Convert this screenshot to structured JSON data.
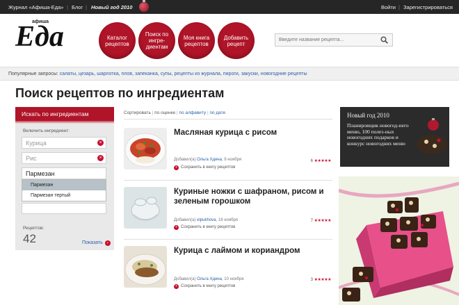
{
  "topbar": {
    "journal": "Журнал «Афиша-Еда»",
    "blog": "Блог",
    "new_year": "Новый год 2010",
    "login": "Войти",
    "register": "Зарегистрироваться",
    "separator": "|"
  },
  "logo": {
    "small": "афиша",
    "main": "Еда"
  },
  "nav": [
    {
      "label": "Каталог рецептов"
    },
    {
      "label": "Поиск по ингре-диентам"
    },
    {
      "label": "Моя книга рецептов"
    },
    {
      "label": "Добавить рецепт"
    }
  ],
  "search": {
    "placeholder": "Введите название рецепта..."
  },
  "popular": {
    "label": "Популярные запросы:",
    "links": [
      "салаты",
      "цезарь",
      "шарлотка",
      "плов",
      "запеканка",
      "супы",
      "рецепты из журнала",
      "пироги",
      "закуски",
      "новогодние рецепты"
    ]
  },
  "page_title": "Поиск рецептов по ингредиентам",
  "panel": {
    "header": "Искать по ингредиентам",
    "include_label": "Включить ингредиент:",
    "ingredients": [
      "Курица",
      "Рис",
      "Пармезан"
    ],
    "suggestions": [
      "Пармезан",
      "Пармезан тертый"
    ],
    "count_label": "Рецептов:",
    "count": "42",
    "show": "Показать"
  },
  "sort": {
    "label": "Сортировать",
    "by_rating": "по оценке",
    "by_alpha": "по алфавиту",
    "by_date": "по дате"
  },
  "recipes": [
    {
      "title": "Масляная курица с рисом",
      "added_by": "Добавил(а)",
      "author": "Ольга Хдина",
      "date": "9 ноября",
      "save": "Сохранить в книгу рецептов",
      "rating": "6",
      "stars": "★★★★★"
    },
    {
      "title": "Куриные ножки с шафраном, рисом и зеленым горошком",
      "added_by": "Добавил(а)",
      "author": "elpukhova",
      "date": "18 ноября",
      "save": "Сохранить в книгу рецептов",
      "rating": "7",
      "stars": "★★★★★"
    },
    {
      "title": "Курица с лаймом и кориандром",
      "added_by": "Добавил(а)",
      "author": "Ольга Хдина",
      "date": "10 ноября",
      "save": "Сохранить в книгу рецептов",
      "rating": "3",
      "stars": "★★★★★"
    }
  ],
  "promo": {
    "title": "Новый год 2010",
    "text": "Планировщик новогод-него меню, 100 полез-ных новогодних подарков и конкурс новогодних меню"
  },
  "colors": {
    "brand_red": "#b01428",
    "topbar": "#262626",
    "link_blue": "#2b5ea8"
  }
}
